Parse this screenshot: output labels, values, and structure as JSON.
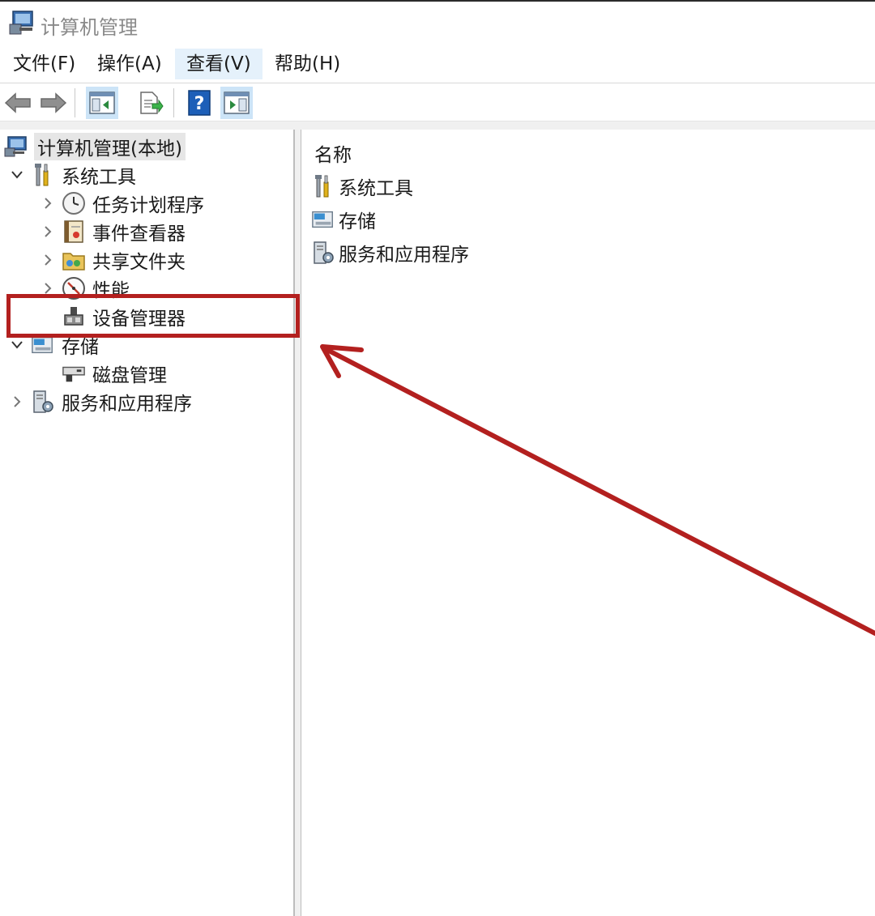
{
  "window": {
    "title": "计算机管理"
  },
  "menu": [
    {
      "label": "文件(F)"
    },
    {
      "label": "操作(A)"
    },
    {
      "label": "查看(V)"
    },
    {
      "label": "帮助(H)"
    }
  ],
  "toolbar": {
    "buttons": [
      "back-arrow-icon",
      "forward-arrow-icon",
      "show-hide-console-tree-icon",
      "export-list-icon",
      "help-icon",
      "show-hide-action-pane-icon"
    ]
  },
  "tree": {
    "root": "计算机管理(本地)",
    "system_tools": "系统工具",
    "task_scheduler": "任务计划程序",
    "event_viewer": "事件查看器",
    "shared_folders": "共享文件夹",
    "performance": "性能",
    "device_manager": "设备管理器",
    "storage": "存储",
    "disk_management": "磁盘管理",
    "services_apps": "服务和应用程序"
  },
  "content": {
    "column_name": "名称",
    "items": [
      {
        "label": "系统工具"
      },
      {
        "label": "存储"
      },
      {
        "label": "服务和应用程序"
      }
    ]
  },
  "annotation": {
    "color": "#b3201f"
  }
}
